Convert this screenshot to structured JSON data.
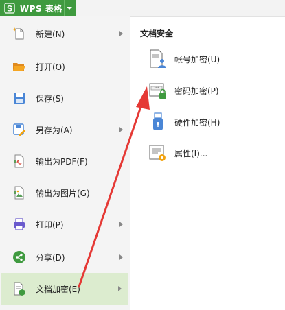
{
  "app": {
    "logo_letter": "S",
    "title": "WPS 表格",
    "brand_color": "#3f9a3f"
  },
  "menu": {
    "items": [
      {
        "label": "新建(N)",
        "icon": "new-document-icon",
        "has_submenu": true
      },
      {
        "label": "打开(O)",
        "icon": "open-folder-icon",
        "has_submenu": false
      },
      {
        "label": "保存(S)",
        "icon": "save-icon",
        "has_submenu": false
      },
      {
        "label": "另存为(A)",
        "icon": "save-as-icon",
        "has_submenu": true
      },
      {
        "label": "输出为PDF(F)",
        "icon": "export-pdf-icon",
        "has_submenu": false
      },
      {
        "label": "输出为图片(G)",
        "icon": "export-image-icon",
        "has_submenu": false
      },
      {
        "label": "打印(P)",
        "icon": "print-icon",
        "has_submenu": true
      },
      {
        "label": "分享(D)",
        "icon": "share-icon",
        "has_submenu": true
      },
      {
        "label": "文档加密(E)",
        "icon": "document-encrypt-icon",
        "has_submenu": true,
        "active": true
      }
    ]
  },
  "submenu": {
    "title": "文档安全",
    "items": [
      {
        "label": "帐号加密(U)",
        "icon": "account-encrypt-icon"
      },
      {
        "label": "密码加密(P)",
        "icon": "password-encrypt-icon"
      },
      {
        "label": "硬件加密(H)",
        "icon": "hardware-encrypt-icon"
      },
      {
        "label": "属性(I)...",
        "icon": "properties-icon"
      }
    ]
  },
  "annotation": {
    "arrow_color": "#e53935",
    "arrow_icon": "red-pointer-arrow"
  }
}
